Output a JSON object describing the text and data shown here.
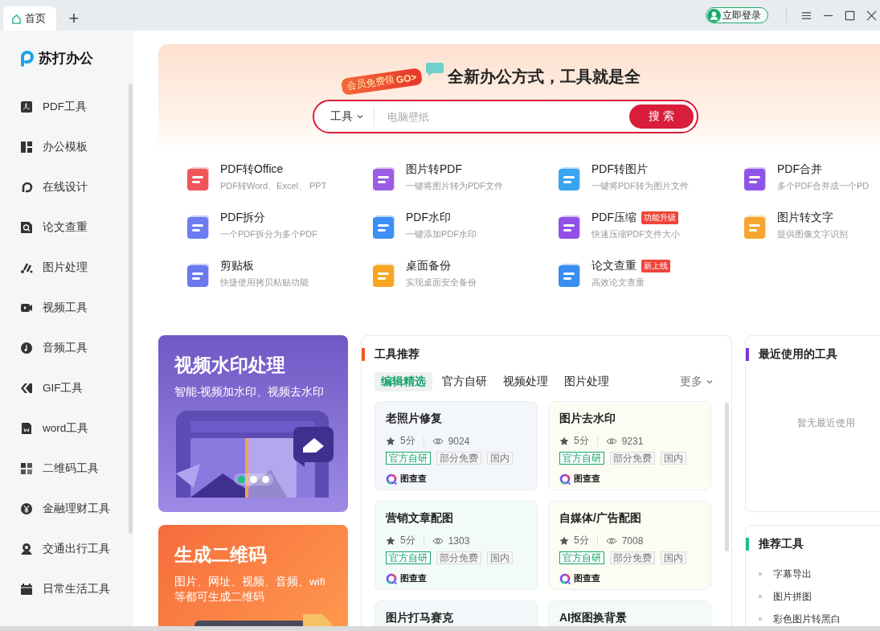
{
  "titlebar": {
    "tabs": [
      {
        "label": "首页",
        "selected": true
      }
    ],
    "new_tab": "+",
    "login": "立即登录"
  },
  "sidebar": {
    "logo": "苏打办公",
    "items": [
      {
        "label": "PDF工具"
      },
      {
        "label": "办公模板"
      },
      {
        "label": "在线设计"
      },
      {
        "label": "论文查重"
      },
      {
        "label": "图片处理"
      },
      {
        "label": "视频工具"
      },
      {
        "label": "音频工具"
      },
      {
        "label": "GIF工具"
      },
      {
        "label": "word工具"
      },
      {
        "label": "二维码工具"
      },
      {
        "label": "金融理财工具"
      },
      {
        "label": "交通出行工具"
      },
      {
        "label": "日常生活工具"
      }
    ]
  },
  "hero": {
    "promo_label": "会员免费领",
    "promo_go": "GO>",
    "title": "全新办公方式，工具就是全",
    "search": {
      "category": "工具",
      "placeholder": "电脑壁纸",
      "button": "搜 索"
    }
  },
  "tools": [
    {
      "name": "PDF转Office",
      "desc": "PDF转Word、Excel、 PPT",
      "color": "#f0555a"
    },
    {
      "name": "图片转PDF",
      "desc": "一键将图片转为PDF文件",
      "color": "#9b5de5"
    },
    {
      "name": "PDF转图片",
      "desc": "一键将PDF转为图片文件",
      "color": "#3aa5f0"
    },
    {
      "name": "PDF合并",
      "desc": "多个PDF合并成一个PD",
      "color": "#8e54e9"
    },
    {
      "name": "PDF拆分",
      "desc": "一个PDF拆分为多个PDF",
      "color": "#6c7cf0"
    },
    {
      "name": "PDF水印",
      "desc": "一键添加PDF水印",
      "color": "#3d8ff5"
    },
    {
      "name": "PDF压缩",
      "desc": "快速压缩PDF文件大小",
      "color": "#9350e6",
      "badge": "功能升级"
    },
    {
      "name": "图片转文字",
      "desc": "提供图像文字识别",
      "color": "#f7a530"
    },
    {
      "name": "剪贴板",
      "desc": "快捷使用拷贝粘贴功能",
      "color": "#6b78ee"
    },
    {
      "name": "桌面备份",
      "desc": "实现桌面安全备份",
      "color": "#f6a623"
    },
    {
      "name": "论文查重",
      "desc": "高效论文查重",
      "color": "#3a8ef0",
      "badge": "新上线"
    }
  ],
  "promos": [
    {
      "kind": "video",
      "title": "视频水印处理",
      "subtitle": "智能-视频加水印、视频去水印",
      "dots": [
        {
          "selected": true
        },
        {
          "selected": false
        },
        {
          "selected": false
        }
      ]
    },
    {
      "kind": "qr",
      "title": "生成二维码",
      "subtitle": "图片、网址、视频、音频、wifi等都可生成二维码"
    }
  ],
  "recommend": {
    "title": "工具推荐",
    "tabs": [
      {
        "label": "编辑精选",
        "selected": true
      },
      {
        "label": "官方自研",
        "selected": false
      },
      {
        "label": "视频处理",
        "selected": false
      },
      {
        "label": "图片处理",
        "selected": false
      }
    ],
    "more": "更多",
    "cards": [
      {
        "title": "老照片修复",
        "rating": "5分",
        "views": "9024",
        "tags": [
          "官方自研",
          "部分免费",
          "国内"
        ],
        "source": "图查查",
        "color": "#f3f6fb"
      },
      {
        "title": "图片去水印",
        "rating": "5分",
        "views": "9231",
        "tags": [
          "官方自研",
          "部分免费",
          "国内"
        ],
        "source": "图查查",
        "color": "#fdfcf3"
      },
      {
        "title": "营销文章配图",
        "rating": "5分",
        "views": "1303",
        "tags": [
          "官方自研",
          "部分免费",
          "国内"
        ],
        "source": "图查查",
        "color": "#f2fbfa"
      },
      {
        "title": "自媒体/广告配图",
        "rating": "5分",
        "views": "7008",
        "tags": [
          "官方自研",
          "部分免费",
          "国内"
        ],
        "source": "图查查",
        "color": "#fcfcf3"
      },
      {
        "title": "图片打马赛克",
        "color": "#f3f9fb"
      },
      {
        "title": "AI抠图换背景",
        "color": "#f4fbf6"
      }
    ]
  },
  "recent": {
    "title": "最近使用的工具",
    "empty": "暂无最近使用"
  },
  "suggested": {
    "title": "推荐工具",
    "items": [
      "字幕导出",
      "图片拼图",
      "彩色图片转黑白"
    ]
  }
}
